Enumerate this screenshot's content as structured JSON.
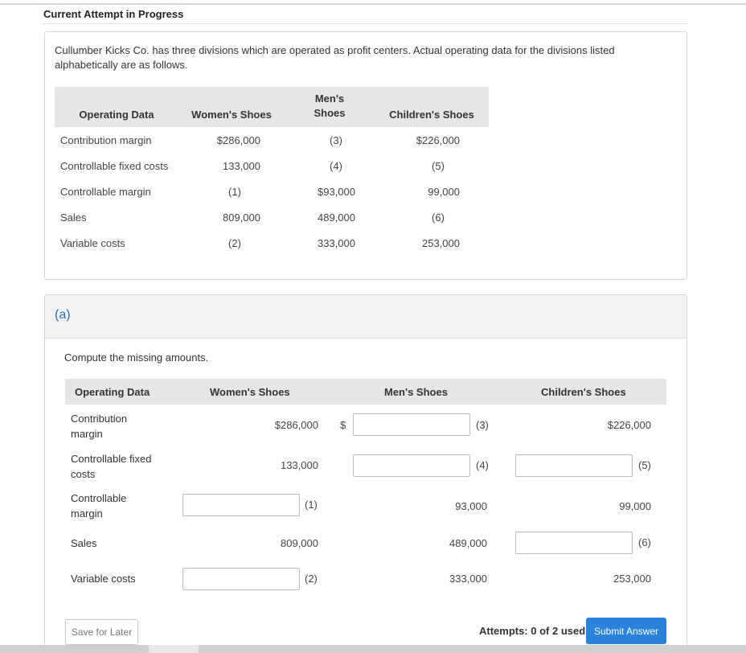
{
  "header": {
    "title": "Current Attempt in Progress"
  },
  "problem": {
    "intro": "Cullumber Kicks Co. has three divisions which are operated as profit centers. Actual operating data for the divisions listed alphabetically are as follows.",
    "table": {
      "headers": [
        "Operating Data",
        "Women's Shoes",
        "Men's Shoes",
        "Children's Shoes"
      ],
      "rows": [
        {
          "label": "Contribution margin",
          "women": "$286,000",
          "men": "(3)",
          "children": "$226,000"
        },
        {
          "label": "Controllable fixed costs",
          "women": "133,000",
          "men": "(4)",
          "children": "(5)"
        },
        {
          "label": "Controllable margin",
          "women": "(1)",
          "men": "$93,000",
          "children": "99,000"
        },
        {
          "label": "Sales",
          "women": "809,000",
          "men": "489,000",
          "children": "(6)"
        },
        {
          "label": "Variable costs",
          "women": "(2)",
          "men": "333,000",
          "children": "253,000"
        }
      ]
    }
  },
  "part_a": {
    "label": "(a)",
    "instruction": "Compute the missing amounts.",
    "headers": [
      "Operating Data",
      "Women's Shoes",
      "Men's Shoes",
      "Children's Shoes"
    ],
    "rows": [
      {
        "label": "Contribution margin",
        "women": "$286,000",
        "dollar": "$",
        "men_input": "",
        "men_marker": "(3)",
        "children": "$226,000"
      },
      {
        "label": "Controllable fixed costs",
        "women": "133,000",
        "men_input": "",
        "men_marker": "(4)",
        "children_input": "",
        "children_marker": "(5)"
      },
      {
        "label": "Controllable margin",
        "women_input": "",
        "women_marker": "(1)",
        "men": "93,000",
        "children": "99,000"
      },
      {
        "label": "Sales",
        "women": "809,000",
        "men": "489,000",
        "children_input": "",
        "children_marker": "(6)"
      },
      {
        "label": "Variable costs",
        "women_input": "",
        "women_marker": "(2)",
        "men": "333,000",
        "children": "253,000"
      }
    ],
    "save_label": "Save for Later",
    "attempts": "Attempts: 0 of 2 used",
    "submit_label": "Submit Answer"
  }
}
